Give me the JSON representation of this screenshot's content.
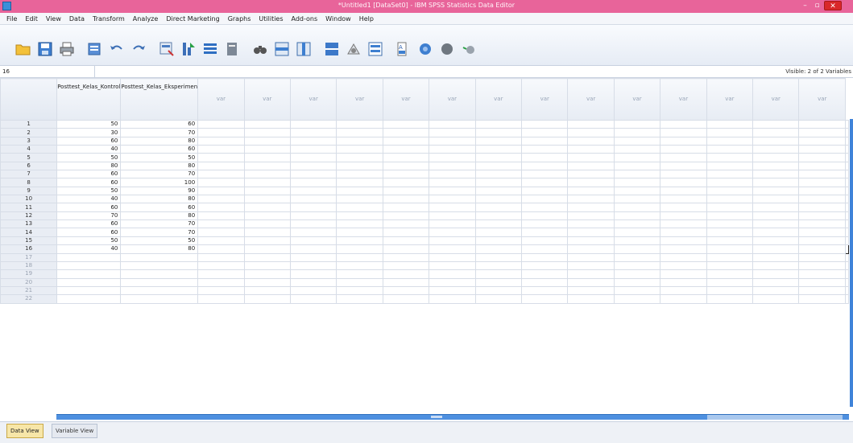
{
  "window": {
    "title": "*Untitled1 [DataSet0] - IBM SPSS Statistics Data Editor",
    "minimize": "–",
    "maximize": "▫",
    "close": "✕"
  },
  "menu": [
    "File",
    "Edit",
    "View",
    "Data",
    "Transform",
    "Analyze",
    "Direct Marketing",
    "Graphs",
    "Utilities",
    "Add-ons",
    "Window",
    "Help"
  ],
  "toolbar_icons": [
    "open-folder-icon",
    "save-icon",
    "print-icon",
    "dialog-recall-icon",
    "undo-icon",
    "redo-icon",
    "goto-case-icon",
    "goto-variable-icon",
    "variables-icon",
    "insert-icon",
    "find-icon",
    "insert-cases-icon",
    "insert-variable-icon",
    "split-file-icon",
    "weight-cases-icon",
    "select-cases-icon",
    "value-labels-icon",
    "use-sets-icon",
    "show-all-icon",
    "spelling-icon"
  ],
  "cell_editor": {
    "name": "16",
    "visible": "Visible: 2 of 2 Variables"
  },
  "columns": [
    {
      "label": "Posttest_Kelas_Kontrol"
    },
    {
      "label": "Posttest_Kelas_Eksperimen"
    }
  ],
  "empty_column_label": "var",
  "empty_column_count": 15,
  "rows": [
    {
      "n": "1",
      "a": "50",
      "b": "60"
    },
    {
      "n": "2",
      "a": "30",
      "b": "70"
    },
    {
      "n": "3",
      "a": "60",
      "b": "80"
    },
    {
      "n": "4",
      "a": "40",
      "b": "60"
    },
    {
      "n": "5",
      "a": "50",
      "b": "50"
    },
    {
      "n": "6",
      "a": "80",
      "b": "80"
    },
    {
      "n": "7",
      "a": "60",
      "b": "70"
    },
    {
      "n": "8",
      "a": "60",
      "b": "100"
    },
    {
      "n": "9",
      "a": "50",
      "b": "90"
    },
    {
      "n": "10",
      "a": "40",
      "b": "80"
    },
    {
      "n": "11",
      "a": "60",
      "b": "60"
    },
    {
      "n": "12",
      "a": "70",
      "b": "80"
    },
    {
      "n": "13",
      "a": "60",
      "b": "70"
    },
    {
      "n": "14",
      "a": "60",
      "b": "70"
    },
    {
      "n": "15",
      "a": "50",
      "b": "50"
    },
    {
      "n": "16",
      "a": "40",
      "b": "80"
    }
  ],
  "empty_rows": [
    "17",
    "18",
    "19",
    "20",
    "21",
    "22"
  ],
  "tabs": {
    "data_view": "Data View",
    "variable_view": "Variable View"
  },
  "colors": {
    "title_bar": "#e8649a",
    "close_button": "#d9282a",
    "scrollbar": "#3f83d9",
    "active_tab": "#f7e6a8"
  }
}
